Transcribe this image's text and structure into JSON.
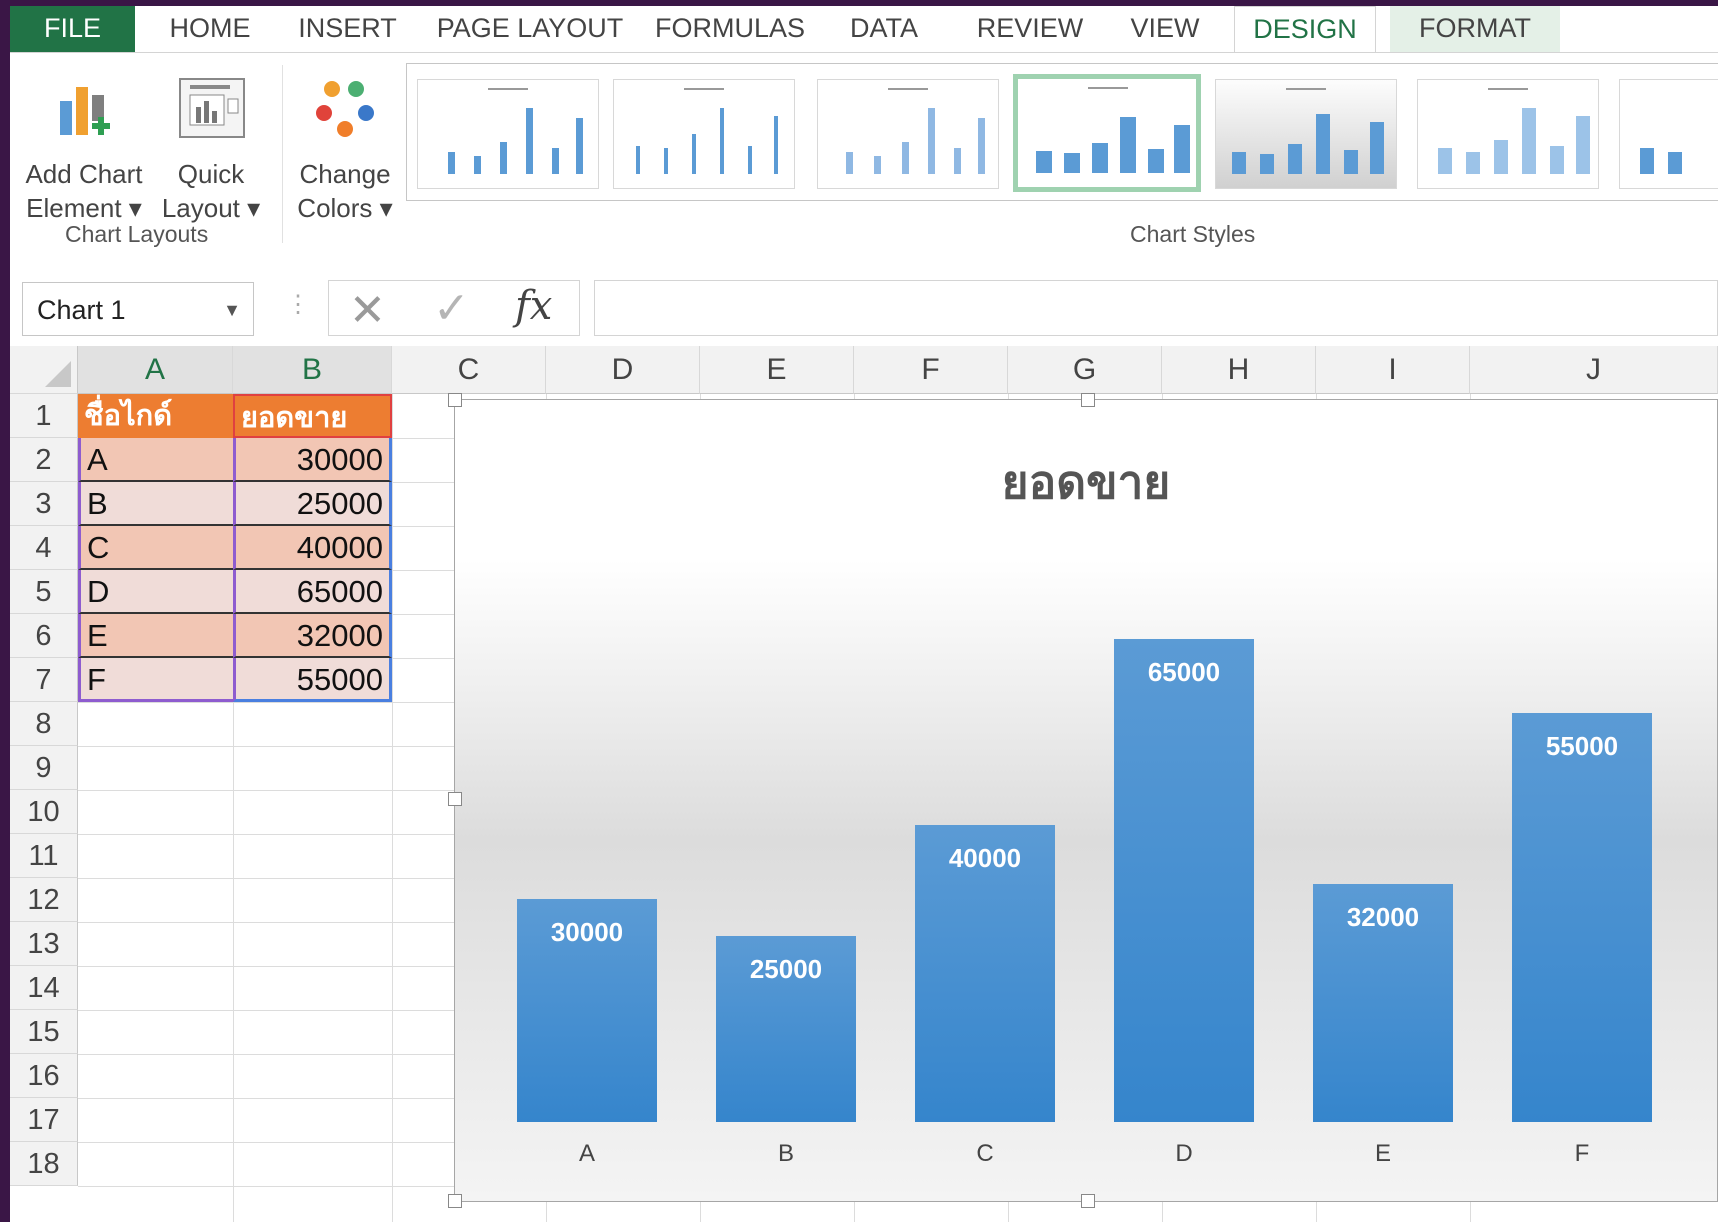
{
  "ribbon_tabs": [
    "FILE",
    "HOME",
    "INSERT",
    "PAGE LAYOUT",
    "FORMULAS",
    "DATA",
    "REVIEW",
    "VIEW",
    "DESIGN",
    "FORMAT"
  ],
  "ribbon": {
    "add_chart_element": {
      "line1": "Add Chart",
      "line2": "Element ▾"
    },
    "quick_layout": {
      "line1": "Quick",
      "line2": "Layout ▾"
    },
    "change_colors": {
      "line1": "Change",
      "line2": "Colors ▾"
    },
    "group_chart_layouts": "Chart Layouts",
    "group_chart_styles": "Chart Styles",
    "selected_style_index": 4
  },
  "formula_bar": {
    "name_box": "Chart 1",
    "dots": "⋮",
    "cancel": "✕",
    "enter": "✓",
    "fx": "fx",
    "formula": ""
  },
  "columns": [
    "A",
    "B",
    "C",
    "D",
    "E",
    "F",
    "G",
    "H",
    "I",
    "J"
  ],
  "rows": [
    "1",
    "2",
    "3",
    "4",
    "5",
    "6",
    "7",
    "8",
    "9",
    "10",
    "11",
    "12",
    "13",
    "14",
    "15",
    "16",
    "17",
    "18"
  ],
  "table": {
    "header": [
      "ชื่อไกด์",
      "ยอดขาย"
    ],
    "rows": [
      [
        "A",
        "30000"
      ],
      [
        "B",
        "25000"
      ],
      [
        "C",
        "40000"
      ],
      [
        "D",
        "65000"
      ],
      [
        "E",
        "32000"
      ],
      [
        "F",
        "55000"
      ]
    ]
  },
  "chart_data": {
    "type": "bar",
    "title": "ยอดขาย",
    "categories": [
      "A",
      "B",
      "C",
      "D",
      "E",
      "F"
    ],
    "values": [
      30000,
      25000,
      40000,
      65000,
      32000,
      55000
    ],
    "ylim": [
      0,
      70000
    ],
    "data_labels": [
      "30000",
      "25000",
      "40000",
      "65000",
      "32000",
      "55000"
    ],
    "colors": {
      "bar": "#5b9bd5",
      "label": "#ffffff"
    }
  },
  "colors": {
    "file_tab": "#217346",
    "design_tab": "#217346",
    "table_header": "#ed7d31"
  }
}
